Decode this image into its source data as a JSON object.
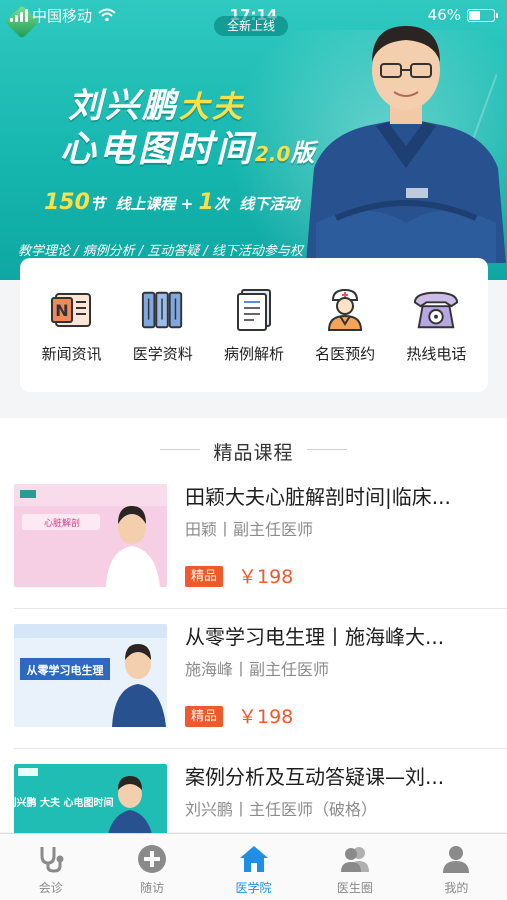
{
  "status_bar": {
    "carrier": "中国移动",
    "time": "17:14",
    "battery": "46%"
  },
  "banner": {
    "launch_pill": "全新上线",
    "title_name": "刘兴鹏",
    "title_role": "大夫",
    "title_line2": "心电图时间",
    "title_version": "2.0",
    "title_version_suffix": "版",
    "offer_count_1": "150",
    "offer_unit_1": "节",
    "offer_text_1": "线上课程 +",
    "offer_count_2": "1",
    "offer_unit_2": "次",
    "offer_text_2": "线下活动",
    "tags": "教学理论 / 病例分析 / 互动答疑 / 线下活动参与权"
  },
  "menu": [
    {
      "label": "新闻资讯",
      "icon": "newspaper-icon"
    },
    {
      "label": "医学资料",
      "icon": "books-icon"
    },
    {
      "label": "病例解析",
      "icon": "document-icon"
    },
    {
      "label": "名医预约",
      "icon": "doctor-icon"
    },
    {
      "label": "热线电话",
      "icon": "telephone-icon"
    }
  ],
  "courses_section": {
    "title": "精品课程"
  },
  "courses": [
    {
      "title": "田颖大夫心脏解剖时间|临床...",
      "teacher": "田颖丨副主任医师",
      "badge": "精品",
      "price": "￥198",
      "thumb_text": "心脏解剖"
    },
    {
      "title": "从零学习电生理丨施海峰大...",
      "teacher": "施海峰丨副主任医师",
      "badge": "精品",
      "price": "￥198",
      "thumb_text": "从零学习电生理"
    },
    {
      "title": "案例分析及互动答疑课—刘...",
      "teacher": "刘兴鹏丨主任医师（破格）",
      "badge": "",
      "price": "",
      "thumb_text": "刘兴鹏 大夫 心电图时间"
    }
  ],
  "tabbar": [
    {
      "label": "会诊",
      "icon": "stethoscope-icon",
      "active": false
    },
    {
      "label": "随访",
      "icon": "plus-circle-icon",
      "active": false
    },
    {
      "label": "医学院",
      "icon": "home-icon",
      "active": true
    },
    {
      "label": "医生圈",
      "icon": "people-icon",
      "active": false
    },
    {
      "label": "我的",
      "icon": "user-icon",
      "active": false
    }
  ],
  "colors": {
    "banner_teal": "#15b5ad",
    "accent_yellow": "#f6e04b",
    "price_orange": "#ee5a2b",
    "tab_active_blue": "#1f8fe6"
  }
}
